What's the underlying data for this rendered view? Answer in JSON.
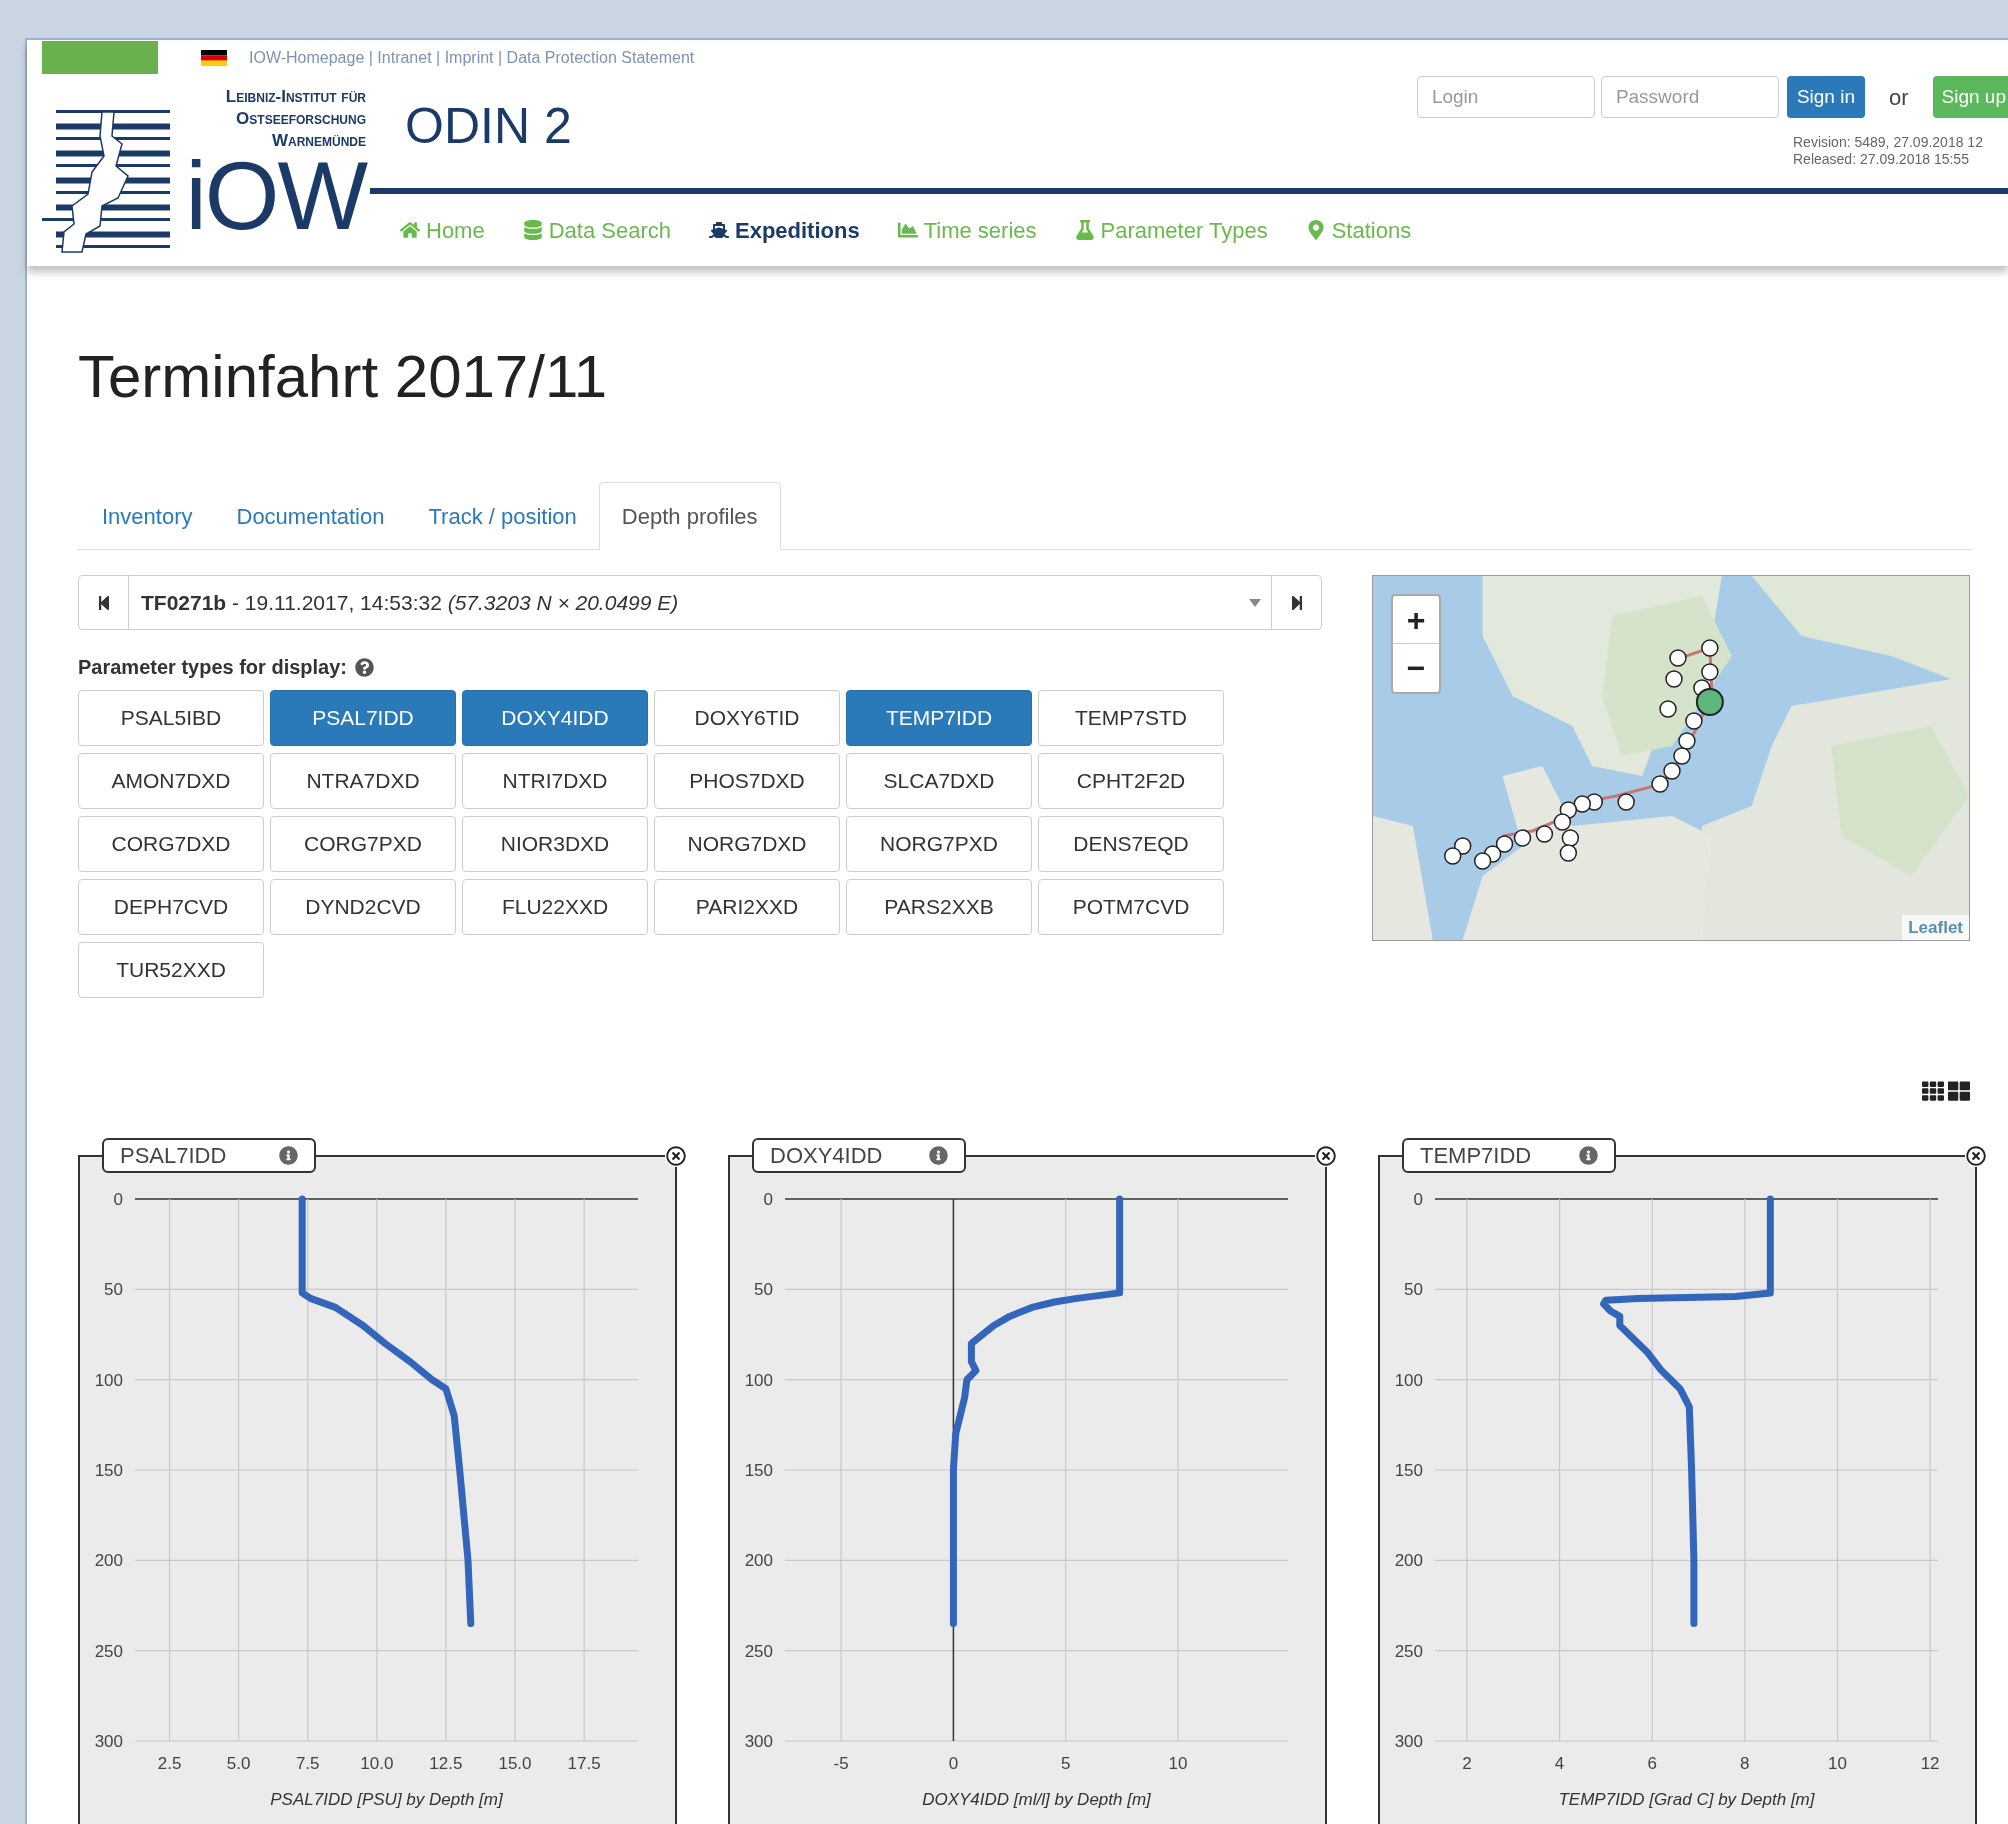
{
  "top_links": "IOW-Homepage | Intranet | Imprint | Data Protection Statement",
  "logo": {
    "lines": [
      "Leibniz-Institut für",
      "Ostseeforschung",
      "Warnemünde"
    ],
    "mark": "iOW"
  },
  "app_title": "ODIN 2",
  "login": {
    "login_placeholder": "Login",
    "password_placeholder": "Password",
    "sign_in": "Sign in",
    "or": "or",
    "sign_up": "Sign up"
  },
  "revision": [
    "Revision: 5489, 27.09.2018 12",
    "Released: 27.09.2018 15:55"
  ],
  "nav": [
    {
      "label": "Home",
      "selected": false
    },
    {
      "label": "Data Search",
      "selected": false
    },
    {
      "label": "Expeditions",
      "selected": true
    },
    {
      "label": "Time series",
      "selected": false
    },
    {
      "label": "Parameter Types",
      "selected": false
    },
    {
      "label": "Stations",
      "selected": false
    }
  ],
  "page_title": "Terminfahrt 2017/11",
  "tabs": [
    {
      "label": "Inventory",
      "selected": false
    },
    {
      "label": "Documentation",
      "selected": false
    },
    {
      "label": "Track / position",
      "selected": false
    },
    {
      "label": "Depth profiles",
      "selected": true
    }
  ],
  "station_select": {
    "value": "**TF0271b** - 19.11.2017, 14:53:32 *(57.3203 N × 20.0499 E)*"
  },
  "parameter_label": "Parameter types for display:",
  "parameters": [
    {
      "label": "PSAL5IBD",
      "selected": false
    },
    {
      "label": "PSAL7IDD",
      "selected": true
    },
    {
      "label": "DOXY4IDD",
      "selected": true
    },
    {
      "label": "DOXY6TID",
      "selected": false
    },
    {
      "label": "TEMP7IDD",
      "selected": true
    },
    {
      "label": "TEMP7STD",
      "selected": false
    },
    {
      "label": "AMON7DXD",
      "selected": false
    },
    {
      "label": "NTRA7DXD",
      "selected": false
    },
    {
      "label": "NTRI7DXD",
      "selected": false
    },
    {
      "label": "PHOS7DXD",
      "selected": false
    },
    {
      "label": "SLCA7DXD",
      "selected": false
    },
    {
      "label": "CPHT2F2D",
      "selected": false
    },
    {
      "label": "CORG7DXD",
      "selected": false
    },
    {
      "label": "CORG7PXD",
      "selected": false
    },
    {
      "label": "NIOR3DXD",
      "selected": false
    },
    {
      "label": "NORG7DXD",
      "selected": false
    },
    {
      "label": "NORG7PXD",
      "selected": false
    },
    {
      "label": "DENS7EQD",
      "selected": false
    },
    {
      "label": "DEPH7CVD",
      "selected": false
    },
    {
      "label": "DYND2CVD",
      "selected": false
    },
    {
      "label": "FLU22XXD",
      "selected": false
    },
    {
      "label": "PARI2XXD",
      "selected": false
    },
    {
      "label": "PARS2XXB",
      "selected": false
    },
    {
      "label": "POTM7CVD",
      "selected": false
    },
    {
      "label": "TUR52XXD",
      "selected": false
    }
  ],
  "map": {
    "zoom_in": "+",
    "zoom_out": "−",
    "attribution": "Leaflet"
  },
  "profiles": [
    {
      "title": "PSAL7IDD",
      "chart_data": {
        "type": "line",
        "xlabel": "PSAL7IDD [PSU] by Depth [m]",
        "x": [
          7.3,
          7.3,
          7.6,
          8.5,
          9.5,
          10.3,
          11.2,
          12.0,
          12.5,
          12.8,
          13.0,
          13.3,
          13.4
        ],
        "series": [
          {
            "color": "#3366bb",
            "values": [
              0,
              52,
              55,
              60,
              70,
              80,
              90,
              100,
              105,
              120,
              150,
              200,
              235
            ]
          }
        ],
        "xlim": [
          1.25,
          19.45
        ],
        "ylim": [
          300,
          0
        ],
        "grid": true,
        "xticks": [
          2.5,
          {
            "value": 5,
            "label": "5.0"
          },
          7.5,
          {
            "value": 10,
            "label": "10.0"
          },
          12.5,
          {
            "value": 15,
            "label": "15.0"
          },
          17.5
        ],
        "yticks": [
          0,
          50,
          100,
          150,
          200,
          250,
          300
        ]
      }
    },
    {
      "title": "DOXY4IDD",
      "chart_data": {
        "type": "line",
        "xlabel": "DOXY4IDD [ml/l] by Depth [m]",
        "x": [
          7.4,
          7.4,
          5.5,
          4.5,
          3.5,
          2.5,
          1.8,
          0.8,
          0.8,
          1.0,
          0.6,
          0.5,
          0.1,
          0,
          0
        ],
        "series": [
          {
            "color": "#3366bb",
            "values": [
              0,
              52,
              55,
              57,
              60,
              65,
              70,
              80,
              90,
              95,
              100,
              110,
              130,
              150,
              235
            ]
          }
        ],
        "xlim": [
          -7.5,
          14.9
        ],
        "ylim": [
          300,
          0
        ],
        "grid": true,
        "xticks": [
          -5,
          0,
          5,
          10
        ],
        "yticks": [
          0,
          50,
          100,
          150,
          200,
          250,
          300
        ]
      }
    },
    {
      "title": "TEMP7IDD",
      "chart_data": {
        "type": "line",
        "xlabel": "TEMP7IDD [Grad C] by Depth [m]",
        "x": [
          8.55,
          8.55,
          7.8,
          5.7,
          5.0,
          4.95,
          5.1,
          5.3,
          5.3,
          5.5,
          5.9,
          6.2,
          6.6,
          6.8,
          6.85,
          6.9,
          6.9
        ],
        "series": [
          {
            "color": "#3366bb",
            "values": [
              0,
              52,
              54,
              55,
              56,
              58,
              62,
              65,
              70,
              75,
              85,
              95,
              105,
              115,
              150,
              200,
              235
            ]
          }
        ],
        "xlim": [
          1.31,
          12.17
        ],
        "ylim": [
          300,
          0
        ],
        "grid": true,
        "xticks": [
          2,
          4,
          6,
          8,
          10,
          12
        ],
        "yticks": [
          0,
          50,
          100,
          150,
          200,
          250,
          300
        ]
      }
    }
  ]
}
